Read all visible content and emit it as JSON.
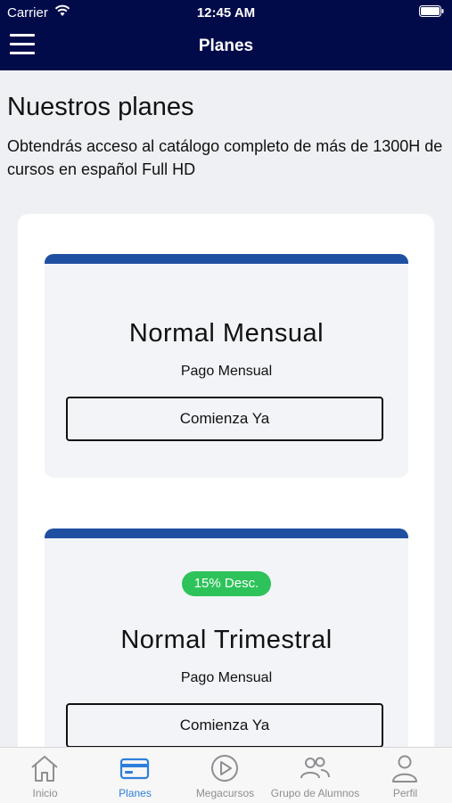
{
  "status_bar": {
    "carrier": "Carrier",
    "time": "12:45 AM"
  },
  "nav": {
    "title": "Planes",
    "menu_icon": "hamburger-menu-icon"
  },
  "main": {
    "title": "Nuestros planes",
    "subtitle": "Obtendrás acceso al catálogo completo de más de 1300H de cursos en español Full HD",
    "plans": [
      {
        "name": "Normal Mensual",
        "description": "Pago Mensual",
        "button": "Comienza Ya"
      },
      {
        "badge": "15% Desc.",
        "name": "Normal Trimestral",
        "description": "Pago Mensual",
        "button": "Comienza Ya"
      }
    ]
  },
  "tabbar": {
    "items": [
      {
        "label": "Inicio",
        "icon": "home-icon"
      },
      {
        "label": "Planes",
        "icon": "card-icon",
        "active": true
      },
      {
        "label": "Megacursos",
        "icon": "play-icon"
      },
      {
        "label": "Grupo de Alumnos",
        "icon": "group-icon"
      },
      {
        "label": "Perfil",
        "icon": "person-icon"
      }
    ]
  },
  "colors": {
    "header_bg": "#020b4a",
    "plan_accent": "#1f4fa0",
    "badge_green": "#2dc35a",
    "tab_active": "#2d7fdc",
    "tab_inactive": "#8e8e93"
  }
}
